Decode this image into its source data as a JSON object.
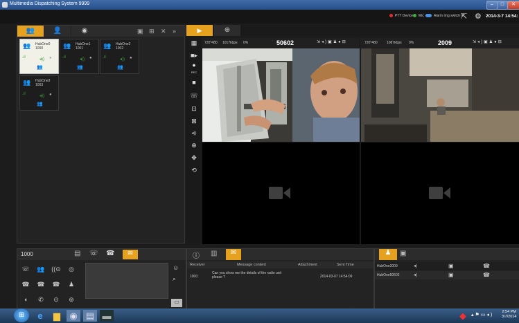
{
  "window": {
    "title": "Multimedia Dispatching System 9999",
    "min": "–",
    "max": "□",
    "close": "✕"
  },
  "status": {
    "ptt_label": "PTT Device",
    "mic_label": "Mic",
    "alarm_label": "Alarm ring switch",
    "datetime": "2014-3-7 14:54:",
    "colors": {
      "ptt": "#e03030",
      "mic": "#3db03d",
      "alarm": "#4a90e2"
    }
  },
  "left_tabs": [
    {
      "icon": "group-icon",
      "glyph": "👥"
    },
    {
      "icon": "user-icon",
      "glyph": "👤"
    },
    {
      "icon": "camera-icon",
      "glyph": "◉"
    }
  ],
  "left_toolbar_icons": [
    "monitor-icon",
    "group-add-icon",
    "close-icon",
    "forward-icon"
  ],
  "devices": [
    {
      "name": "HubOne0",
      "id": "1000",
      "selected": true
    },
    {
      "name": "HubOne1",
      "id": "1001",
      "selected": false
    },
    {
      "name": "HubOne2",
      "id": "1002",
      "selected": false
    },
    {
      "name": "HubOne3",
      "id": "1003",
      "selected": false
    }
  ],
  "video_tabs": [
    {
      "icon": "video-camera-icon",
      "glyph": "▶"
    },
    {
      "icon": "add-icon",
      "glyph": "+"
    }
  ],
  "video_side_buttons": [
    {
      "icon": "grid-layout-icon",
      "glyph": "▦"
    },
    {
      "icon": "speaker-out-icon",
      "glyph": "■▸"
    },
    {
      "icon": "record-icon",
      "glyph": "●",
      "label": "REC"
    },
    {
      "icon": "stop-icon",
      "glyph": "■"
    },
    {
      "icon": "call-icon",
      "glyph": "☎"
    },
    {
      "icon": "snapshot-icon",
      "glyph": "⊡"
    },
    {
      "icon": "snapshot-alt-icon",
      "glyph": "⊠"
    },
    {
      "icon": "volume-icon",
      "glyph": "◂))"
    },
    {
      "icon": "link-icon",
      "glyph": "⊕"
    },
    {
      "icon": "ptz-icon",
      "glyph": "✥"
    },
    {
      "icon": "rotate-icon",
      "glyph": "⟲"
    }
  ],
  "streams": [
    {
      "resolution": "720*480",
      "bitrate": "1017kbps",
      "loss": "0%",
      "id": "50602"
    },
    {
      "resolution": "720*480",
      "bitrate": "1087kbps",
      "loss": "0%",
      "id": "2009"
    }
  ],
  "call_panel": {
    "number": "1000"
  },
  "messages": {
    "columns": [
      "Receiver",
      "Message content",
      "Attachment",
      "Sent Time"
    ],
    "rows": [
      {
        "receiver": "1000",
        "content": "Can you show me the details of the radio unit please ?",
        "attachment": "",
        "time": "2014-03-07 14:54:09"
      }
    ]
  },
  "video_list": {
    "rows": [
      {
        "name": "HubOne2009"
      },
      {
        "name": "HubOne50602"
      }
    ]
  },
  "taskbar": {
    "time": "2:54 PM",
    "date": "3/7/2014"
  }
}
